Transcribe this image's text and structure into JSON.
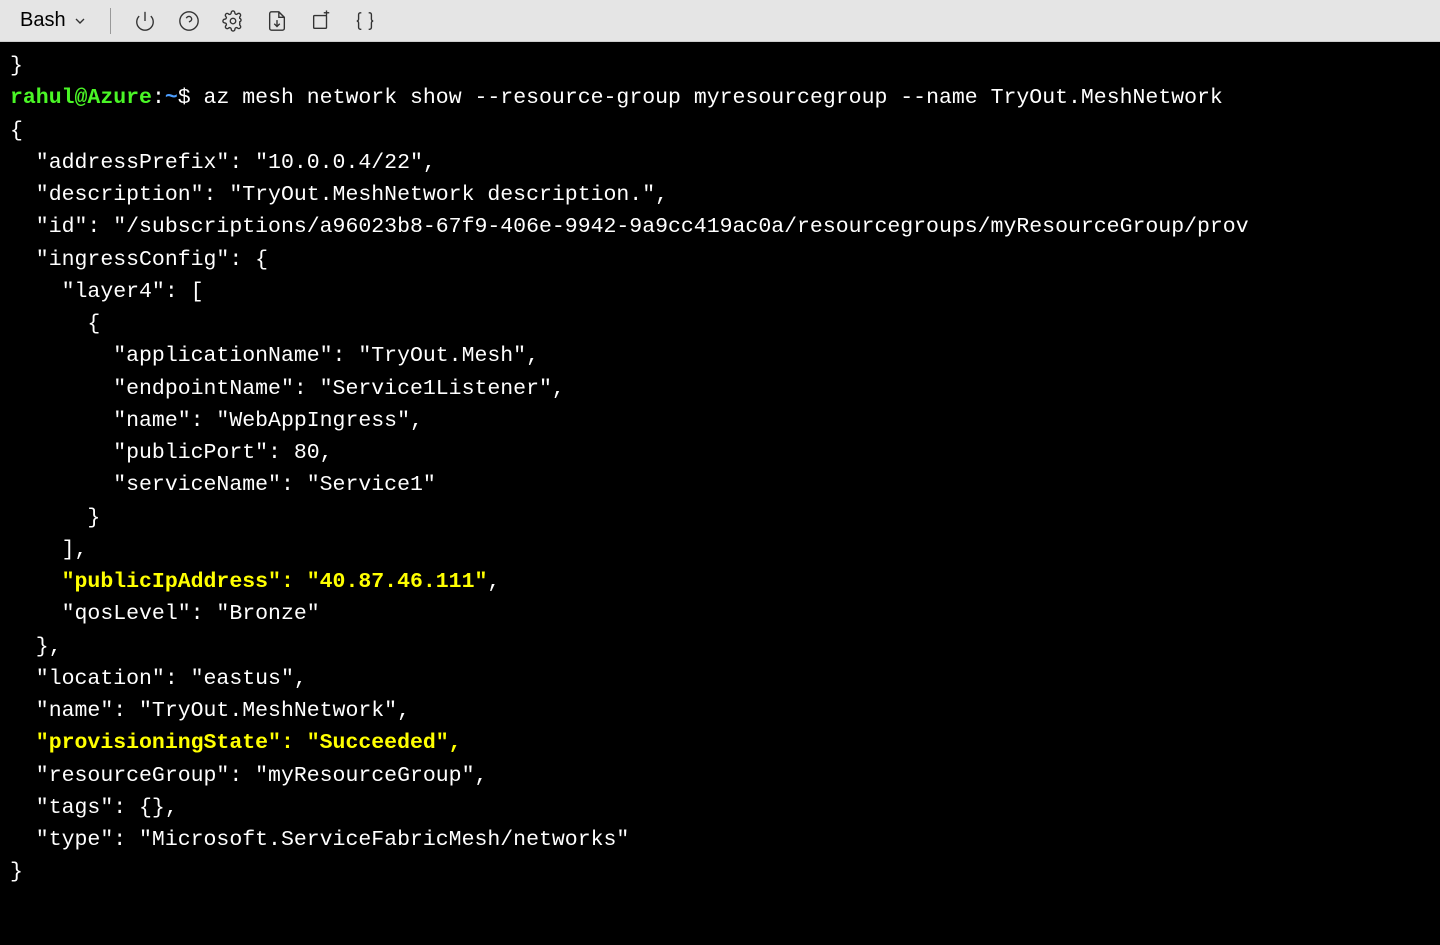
{
  "toolbar": {
    "shell_label": "Bash",
    "icons": {
      "power": "power-icon",
      "help": "help-icon",
      "settings": "gear-icon",
      "download": "download-file-icon",
      "upload": "upload-file-icon",
      "braces": "braces-icon"
    }
  },
  "terminal": {
    "pre_output": "}",
    "prompt": {
      "user": "rahul",
      "at": "@",
      "host": "Azure",
      "colon": ":",
      "path": "~",
      "dollar": "$"
    },
    "command": " az mesh network show --resource-group myresourcegroup --name TryOut.MeshNetwork",
    "output_lines": {
      "l01": "{",
      "l02": "  \"addressPrefix\": \"10.0.0.4/22\",",
      "l03": "  \"description\": \"TryOut.MeshNetwork description.\",",
      "l04": "  \"id\": \"/subscriptions/a96023b8-67f9-406e-9942-9a9cc419ac0a/resourcegroups/myResourceGroup/prov",
      "l05": "  \"ingressConfig\": {",
      "l06": "    \"layer4\": [",
      "l07": "      {",
      "l08": "        \"applicationName\": \"TryOut.Mesh\",",
      "l09": "        \"endpointName\": \"Service1Listener\",",
      "l10": "        \"name\": \"WebAppIngress\",",
      "l11": "        \"publicPort\": 80,",
      "l12": "        \"serviceName\": \"Service1\"",
      "l13": "      }",
      "l14": "    ],",
      "l15_hl": "    \"publicIpAddress\": \"40.87.46.111\"",
      "l15_post": ",",
      "l16": "    \"qosLevel\": \"Bronze\"",
      "l17": "  },",
      "l18": "  \"location\": \"eastus\",",
      "l19": "  \"name\": \"TryOut.MeshNetwork\",",
      "l20_hl": "  \"provisioningState\": \"Succeeded\",",
      "l21": "  \"resourceGroup\": \"myResourceGroup\",",
      "l22": "  \"tags\": {},",
      "l23": "  \"type\": \"Microsoft.ServiceFabricMesh/networks\"",
      "l24": "}"
    }
  }
}
